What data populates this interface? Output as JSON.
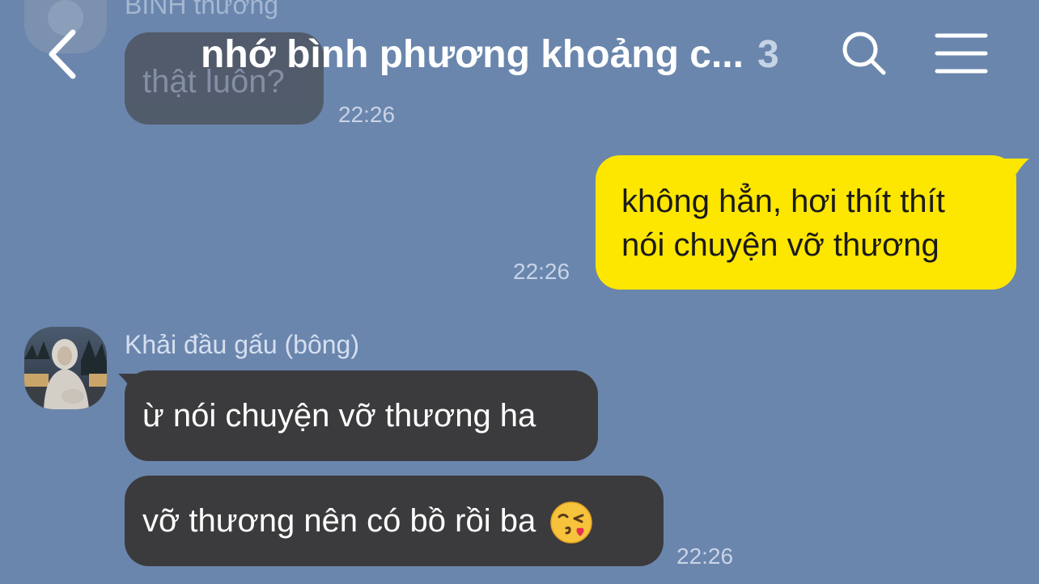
{
  "header": {
    "title": "nhớ bình phương khoảng c...",
    "member_count": "3",
    "back_icon": "chevron-left-icon",
    "search_icon": "search-icon",
    "menu_icon": "hamburger-menu-icon"
  },
  "colors": {
    "background": "#6a86ad",
    "incoming_bubble": "#3b3b3d",
    "outgoing_bubble": "#fde600",
    "timestamp": "#c8d3e6"
  },
  "messages": [
    {
      "id": "msg-top-partial",
      "direction": "incoming",
      "sender": "BÌNH thường",
      "text": "thật luôn?",
      "time": "22:26"
    },
    {
      "id": "msg-outgoing",
      "direction": "outgoing",
      "lines": [
        "không hẳn, hơi thít thít",
        "nói chuyện vỡ thương"
      ],
      "time": "22:26"
    },
    {
      "id": "msg-khai-1",
      "direction": "incoming",
      "sender": "Khải đầu gấu (bông)",
      "text": "ừ nói chuyện vỡ thương ha"
    },
    {
      "id": "msg-khai-2",
      "direction": "incoming",
      "text": "vỡ thương nên có bồ rồi ba",
      "emoji": "face-blowing-kiss",
      "time": "22:26"
    }
  ]
}
